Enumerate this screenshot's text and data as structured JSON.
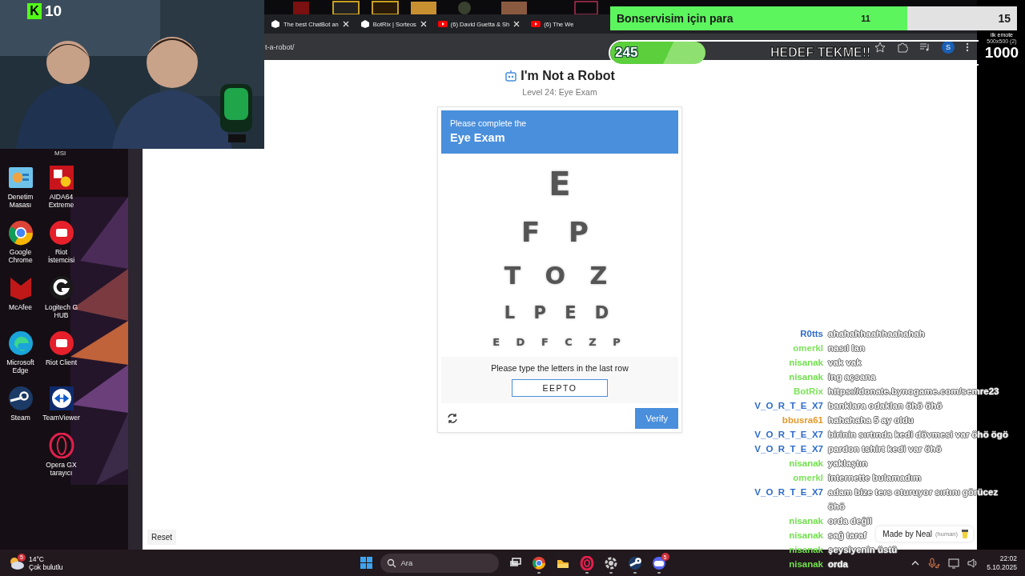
{
  "webcam": {
    "kind": "picture",
    "logo": "K",
    "viewer_count": "10"
  },
  "browser": {
    "tabs": [
      {
        "title": "The best ChatBot an",
        "kind": "botrix",
        "selected": false
      },
      {
        "title": "BotRix | Sorteos",
        "kind": "botrix",
        "selected": false
      },
      {
        "title": "(6) David Guetta & Sh",
        "kind": "youtube",
        "selected": false
      },
      {
        "title": "(6) The We",
        "kind": "youtube",
        "selected": false
      }
    ],
    "address": "t-a-robot/",
    "profile": "S"
  },
  "page": {
    "title": "I'm Not a Robot",
    "subtitle": "Level 24: Eye Exam",
    "card": {
      "header_line": "Please complete the",
      "header_title": "Eye Exam",
      "chart_rows": [
        {
          "letters": "E",
          "blurred": true
        },
        {
          "letters": "F P",
          "blurred": true
        },
        {
          "letters": "T O Z",
          "blurred": true
        },
        {
          "letters": "L P E D",
          "blurred": true
        },
        {
          "letters": "E D F C Z P",
          "blurred": true
        }
      ],
      "instruction": "Please type the letters in the last row",
      "answer": "EEPTO",
      "verify_button": "Verify"
    },
    "reset_button": "Reset",
    "credit": {
      "text": "Made by Neal",
      "note": "(human)"
    }
  },
  "goal_bar": {
    "label": "Bonservisim için para",
    "current": "11",
    "target": "15",
    "level": 0.73
  },
  "kick_goal": {
    "current": "245",
    "title": "HEDEF TEKME!!",
    "note": "ilk emote",
    "detail": "500x500 (2)",
    "target": "1000",
    "level": 0.245
  },
  "desktop": {
    "cut_label": "MSI",
    "icons": [
      {
        "label": "Denetim Masası",
        "kind": "control-panel"
      },
      {
        "label": "AIDA64 Extreme",
        "kind": "aida"
      },
      {
        "label": "Google Chrome",
        "kind": "chrome"
      },
      {
        "label": "Riot İstemcisi",
        "kind": "riot"
      },
      {
        "label": "McAfee",
        "kind": "mcafee"
      },
      {
        "label": "Logitech G HUB",
        "kind": "logitech"
      },
      {
        "label": "Microsoft Edge",
        "kind": "edge"
      },
      {
        "label": "Riot Client",
        "kind": "riot"
      },
      {
        "label": "Steam",
        "kind": "steam"
      },
      {
        "label": "TeamViewer",
        "kind": "teamviewer"
      },
      {
        "label": "Opera GX tarayıcı",
        "kind": "opera"
      }
    ]
  },
  "chat": [
    {
      "name": "R0tts",
      "color": "#2e6cc8",
      "text": "ahahahhaahhaahahah"
    },
    {
      "name": "omerkl",
      "color": "#7ee35c",
      "text": "nasıl lan"
    },
    {
      "name": "nisanak",
      "color": "#72e04e",
      "text": "vak vak"
    },
    {
      "name": "nisanak",
      "color": "#72e04e",
      "text": "ing açsana"
    },
    {
      "name": "BotRix",
      "color": "#7ee35c",
      "text": "https://donate.bynogame.com/semre23"
    },
    {
      "name": "V_O_R_T_E_X7",
      "color": "#2e6cc8",
      "text": "banklara odaklan öhö öhö"
    },
    {
      "name": "bbusra61",
      "color": "#e39a2c",
      "text": "hahahaha 5 ay oldu"
    },
    {
      "name": "V_O_R_T_E_X7",
      "color": "#2e6cc8",
      "text": "birinin sırtında kedi dövmesi var öhö ögö"
    },
    {
      "name": "V_O_R_T_E_X7",
      "color": "#2e6cc8",
      "text": "pardon tshirt kedi var öhö"
    },
    {
      "name": "nisanak",
      "color": "#72e04e",
      "text": "yaklaştın"
    },
    {
      "name": "omerkl",
      "color": "#7ee35c",
      "text": "internette bulamadım"
    },
    {
      "name": "V_O_R_T_E_X7",
      "color": "#2e6cc8",
      "text": "adam bize ters oturuyor sırtını görücez öhö"
    },
    {
      "name": "nisanak",
      "color": "#72e04e",
      "text": "orda değil"
    },
    {
      "name": "nisanak",
      "color": "#72e04e",
      "text": "sağ taraf"
    },
    {
      "name": "nisanak",
      "color": "#72e04e",
      "text": "şeysiyenin üstü"
    },
    {
      "name": "nisanak",
      "color": "#72e04e",
      "text": "orda"
    }
  ],
  "taskbar": {
    "weather_badge": "5",
    "temperature": "14°C",
    "weather": "Çok bulutlu",
    "search_placeholder": "Ara",
    "apps": [
      {
        "kind": "task-view",
        "running": false
      },
      {
        "kind": "chrome",
        "running": true
      },
      {
        "kind": "folder",
        "running": false
      },
      {
        "kind": "opera",
        "running": true
      },
      {
        "kind": "gear",
        "running": true
      },
      {
        "kind": "steam",
        "running": true
      },
      {
        "kind": "discord",
        "running": true,
        "badge": "5"
      }
    ],
    "time": "22:02",
    "date": "5.10.2025"
  }
}
